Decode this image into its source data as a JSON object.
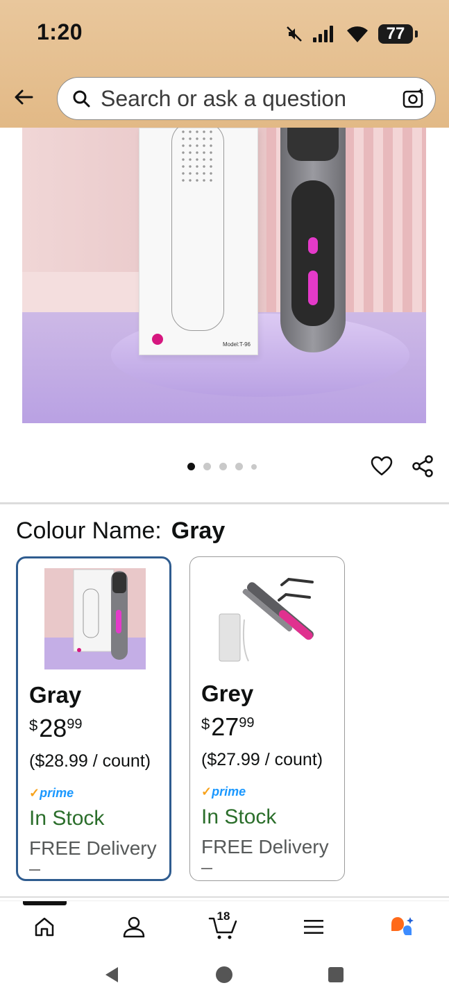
{
  "status_bar": {
    "time": "1:20",
    "battery": "77"
  },
  "search": {
    "placeholder": "Search or ask a question"
  },
  "product_image": {
    "model_label": "Model:T-96",
    "page_count": 5,
    "active_page": 1
  },
  "colour": {
    "label": "Colour Name:",
    "selected": "Gray"
  },
  "variants": [
    {
      "name": "Gray",
      "currency": "$",
      "price_whole": "28",
      "price_fraction": "99",
      "unit_price": "($28.99 / count)",
      "prime": "prime",
      "stock": "In Stock",
      "delivery": "FREE Delivery"
    },
    {
      "name": "Grey",
      "currency": "$",
      "price_whole": "27",
      "price_fraction": "99",
      "unit_price": "($27.99 / count)",
      "prime": "prime",
      "stock": "In Stock",
      "delivery": "FREE Delivery"
    }
  ],
  "bottom_nav": {
    "cart_count": "18"
  },
  "colors": {
    "header_bg": "#e4bc8a",
    "selected_border": "#2f5c8f",
    "stock_green": "#2b6e2b",
    "prime_blue": "#1a98ff",
    "alexa_orange": "#ff6a1a",
    "alexa_blue": "#3d8cff"
  },
  "icons": [
    "mute-icon",
    "signal-icon",
    "wifi-icon",
    "battery-icon",
    "back-arrow-icon",
    "search-icon",
    "camera-icon",
    "heart-icon",
    "share-icon",
    "home-icon",
    "account-icon",
    "cart-icon",
    "menu-icon",
    "rufus-icon"
  ]
}
